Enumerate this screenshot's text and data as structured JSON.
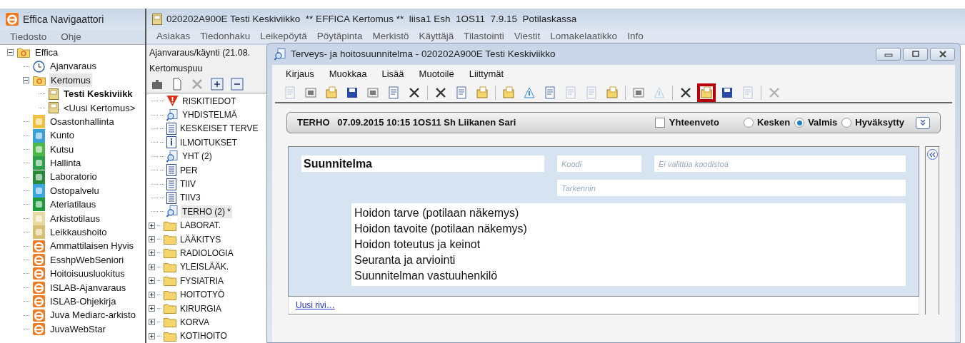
{
  "navigator": {
    "title": "Effica Navigaattori",
    "menu": [
      "Tiedosto",
      "Ohje"
    ],
    "tree": [
      {
        "label": "Effica",
        "kind": "folder",
        "expanded": true,
        "selected": false,
        "children": [
          {
            "label": "Ajanvaraus",
            "kind": "clock",
            "selected": false
          },
          {
            "label": "Kertomus",
            "kind": "folder",
            "expanded": true,
            "selected": true,
            "children": [
              {
                "label": "Testi Keskiviikk",
                "kind": "doc",
                "bold": true,
                "selected": false
              },
              {
                "label": "<Uusi Kertomus>",
                "kind": "doc",
                "bold": false,
                "selected": false
              }
            ]
          },
          {
            "label": "Osastonhallinta",
            "kind": "tile",
            "selected": false
          },
          {
            "label": "Kunto",
            "kind": "tile",
            "selected": false
          },
          {
            "label": "Kutsu",
            "kind": "tile",
            "selected": false
          },
          {
            "label": "Hallinta",
            "kind": "tile",
            "selected": false
          },
          {
            "label": "Laboratorio",
            "kind": "tile",
            "selected": false
          },
          {
            "label": "Ostopalvelu",
            "kind": "tile",
            "selected": false
          },
          {
            "label": "Ateriatilaus",
            "kind": "tile",
            "selected": false
          },
          {
            "label": "Arkistotilaus",
            "kind": "tile",
            "selected": false
          },
          {
            "label": "Leikkaushoito",
            "kind": "tile",
            "selected": false
          },
          {
            "label": "Ammattilaisen Hyvis",
            "kind": "app",
            "selected": false
          },
          {
            "label": "EsshpWebSeniori",
            "kind": "app",
            "selected": false
          },
          {
            "label": "Hoitoisuusluokitus",
            "kind": "app",
            "selected": false
          },
          {
            "label": "ISLAB-Ajanvaraus",
            "kind": "app",
            "selected": false
          },
          {
            "label": "ISLAB-Ohjekirja",
            "kind": "app",
            "selected": false
          },
          {
            "label": "Juva Mediarc-arkisto",
            "kind": "app",
            "selected": false
          },
          {
            "label": "JuvaWebStar",
            "kind": "app",
            "selected": false
          }
        ]
      }
    ]
  },
  "main": {
    "title": "020202A900E Testi Keskiviikko  ** EFFICA Kertomus **  liisa1 Esh  1OS11  7.9.15  Potilaskassa",
    "menu": [
      "Asiakas",
      "Tiedonhaku",
      "Leikepöytä",
      "Pöytäpinta",
      "Merkistö",
      "Käyttäjä",
      "Tilastointi",
      "Viestit",
      "Lomakelaatikko",
      "Info"
    ]
  },
  "record_panel": {
    "visit": "Ajanvaraus/käynti (21.08.",
    "tree_title": "Kertomuspuu",
    "items": [
      {
        "label": "RISKITIEDOT",
        "kind": "warning",
        "selected": false
      },
      {
        "label": "YHDISTELMÄ",
        "kind": "search",
        "selected": false
      },
      {
        "label": "KESKEISET TERVE",
        "kind": "page",
        "selected": false
      },
      {
        "label": "ILMOITUKSET",
        "kind": "info",
        "selected": false
      },
      {
        "label": "YHT (2)",
        "kind": "search",
        "selected": false
      },
      {
        "label": "PER",
        "kind": "page",
        "selected": false
      },
      {
        "label": "TIIV",
        "kind": "page",
        "selected": false
      },
      {
        "label": "TIIV3",
        "kind": "page",
        "selected": false
      },
      {
        "label": "TERHO (2) *",
        "kind": "search",
        "selected": true
      },
      {
        "label": "LABORAT.",
        "kind": "folder",
        "selected": false
      },
      {
        "label": "LÄÄKITYS",
        "kind": "folder",
        "selected": false
      },
      {
        "label": "RADIOLOGIA",
        "kind": "folder",
        "selected": false
      },
      {
        "label": "YLEISLÄÄK.",
        "kind": "folder",
        "selected": false
      },
      {
        "label": "FYSIATRIA",
        "kind": "folder",
        "selected": false
      },
      {
        "label": "HOITOTYÖ",
        "kind": "folder",
        "selected": false
      },
      {
        "label": "KIRURGIA",
        "kind": "folder",
        "selected": false
      },
      {
        "label": "KORVA",
        "kind": "folder",
        "selected": false
      },
      {
        "label": "KOTIHOITO",
        "kind": "folder",
        "selected": false
      }
    ]
  },
  "dialog": {
    "title": "Terveys- ja hoitosuunnitelma - 020202A900E Testi Keskiviikko",
    "menu": [
      "Kirjaus",
      "Muokkaa",
      "Lisää",
      "Muotoile",
      "Liittymät"
    ],
    "toolbar": [
      {
        "disabled": true,
        "highlighted": false
      },
      {
        "disabled": false,
        "highlighted": false
      },
      {
        "disabled": false,
        "highlighted": false
      },
      {
        "disabled": false,
        "highlighted": false
      },
      {
        "disabled": false,
        "highlighted": false
      },
      {
        "disabled": false,
        "highlighted": false
      },
      {
        "disabled": false,
        "highlighted": false
      },
      {
        "disabled": false,
        "highlighted": false
      },
      {
        "disabled": false,
        "highlighted": false
      },
      {
        "disabled": false,
        "highlighted": false
      },
      {
        "disabled": false,
        "highlighted": false
      },
      {
        "disabled": false,
        "highlighted": false
      },
      {
        "disabled": false,
        "highlighted": false
      },
      {
        "disabled": true,
        "highlighted": false
      },
      {
        "disabled": true,
        "highlighted": false
      },
      {
        "disabled": false,
        "highlighted": false
      },
      {
        "disabled": false,
        "highlighted": false
      },
      {
        "disabled": true,
        "highlighted": false
      },
      {
        "disabled": false,
        "highlighted": false
      },
      {
        "disabled": false,
        "highlighted": true
      },
      {
        "disabled": false,
        "highlighted": false
      },
      {
        "disabled": true,
        "highlighted": false
      },
      {
        "disabled": true,
        "highlighted": false
      }
    ],
    "entry": {
      "header": "TERHO   07.09.2015 10:15 1OS11 Sh Liikanen Sari",
      "summary": {
        "label": "Yhteenveto",
        "checked": false
      },
      "statuses": [
        {
          "label": "Kesken",
          "selected": false
        },
        {
          "label": "Valmis",
          "selected": true
        },
        {
          "label": "Hyväksytty",
          "selected": false
        }
      ]
    },
    "section": {
      "heading": "Suunnitelma",
      "code_placeholder": "Koodi",
      "codeset_placeholder": "Ei valittua koodistoa",
      "specifier_placeholder": "Tarkennin",
      "lines": [
        "Hoidon tarve (potilaan näkemys)",
        "Hoidon tavoite (potilaan näkemys)",
        "Hoidon toteutus ja keinot",
        "Seuranta ja arviointi",
        "Suunnitelman vastuuhenkilö"
      ]
    },
    "new_row_link": "Uusi rivi…"
  }
}
